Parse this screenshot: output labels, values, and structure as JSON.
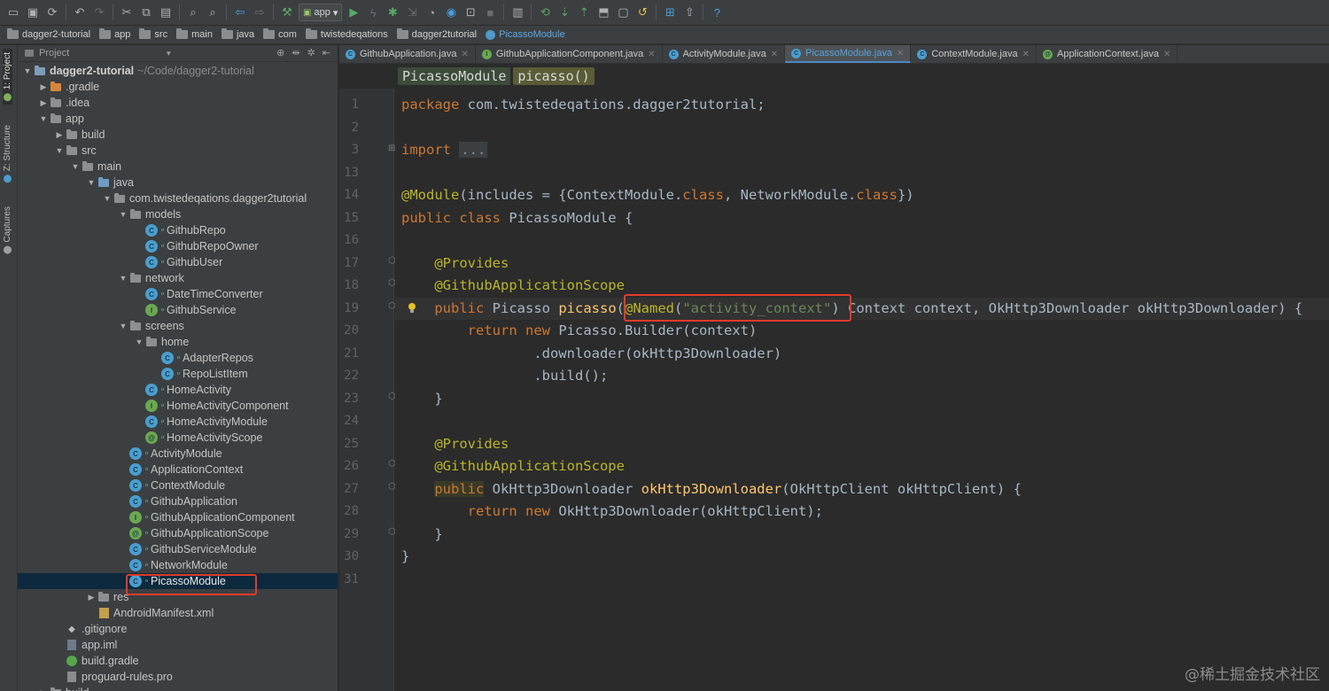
{
  "toolbar": {
    "run_config": "app"
  },
  "navbar": {
    "crumbs": [
      "dagger2-tutorial",
      "app",
      "src",
      "main",
      "java",
      "com",
      "twistedeqations",
      "dagger2tutorial",
      "PicassoModule"
    ]
  },
  "left_stripe": {
    "project_tab": "1: Project",
    "structure_tab": "Z: Structure",
    "captures_tab": "Captures"
  },
  "project_panel": {
    "header": "Project",
    "root_label": "dagger2-tutorial",
    "root_path": "~/Code/dagger2-tutorial",
    "tree": [
      {
        "label": ".gradle"
      },
      {
        "label": ".idea"
      },
      {
        "label": "app"
      },
      {
        "label": "build"
      },
      {
        "label": "src"
      },
      {
        "label": "main"
      },
      {
        "label": "java"
      },
      {
        "label": "com.twistedeqations.dagger2tutorial"
      },
      {
        "label": "models"
      },
      {
        "label": "GithubRepo"
      },
      {
        "label": "GithubRepoOwner"
      },
      {
        "label": "GithubUser"
      },
      {
        "label": "network"
      },
      {
        "label": "DateTimeConverter"
      },
      {
        "label": "GithubService"
      },
      {
        "label": "screens"
      },
      {
        "label": "home"
      },
      {
        "label": "AdapterRepos"
      },
      {
        "label": "RepoListItem"
      },
      {
        "label": "HomeActivity"
      },
      {
        "label": "HomeActivityComponent"
      },
      {
        "label": "HomeActivityModule"
      },
      {
        "label": "HomeActivityScope"
      },
      {
        "label": "ActivityModule"
      },
      {
        "label": "ApplicationContext"
      },
      {
        "label": "ContextModule"
      },
      {
        "label": "GithubApplication"
      },
      {
        "label": "GithubApplicationComponent"
      },
      {
        "label": "GithubApplicationScope"
      },
      {
        "label": "GithubServiceModule"
      },
      {
        "label": "NetworkModule"
      },
      {
        "label": "PicassoModule"
      },
      {
        "label": "res"
      },
      {
        "label": "AndroidManifest.xml"
      },
      {
        "label": ".gitignore"
      },
      {
        "label": "app.iml"
      },
      {
        "label": "build.gradle"
      },
      {
        "label": "proguard-rules.pro"
      },
      {
        "label": "build"
      }
    ]
  },
  "editor": {
    "tabs": [
      {
        "label": "GithubApplication.java",
        "active": false
      },
      {
        "label": "GithubApplicationComponent.java",
        "active": false
      },
      {
        "label": "ActivityModule.java",
        "active": false
      },
      {
        "label": "PicassoModule.java",
        "active": true
      },
      {
        "label": "ContextModule.java",
        "active": false
      },
      {
        "label": "ApplicationContext.java",
        "active": false
      }
    ],
    "breadcrumb_class": "PicassoModule",
    "breadcrumb_method": "picasso()",
    "line_numbers": [
      "1",
      "2",
      "3",
      "13",
      "14",
      "15",
      "16",
      "17",
      "18",
      "19",
      "20",
      "21",
      "22",
      "23",
      "24",
      "25",
      "26",
      "27",
      "28",
      "29",
      "30",
      "31"
    ],
    "code": {
      "l1_kw": "package",
      "l1_rest": " com.twistedeqations.dagger2tutorial;",
      "l3_kw": "import",
      "l3_fold": "...",
      "l14_ann": "@Module",
      "l14_a": "(includes = {ContextModule.",
      "l14_kw1": "class",
      "l14_b": ", NetworkModule.",
      "l14_kw2": "class",
      "l14_c": "})",
      "l15_kw": "public class",
      "l15_rest": " PicassoModule {",
      "l17_ann": "@Provides",
      "l18_ann": "@GithubApplicationScope",
      "l19_kw": "public",
      "l19_a": " Picasso ",
      "l19_fn": "picasso",
      "l19_b": "(",
      "l19_ann": "@Named",
      "l19_c": "(",
      "l19_str": "\"activity_context\"",
      "l19_d": ") Context context, OkHttp3Downloader okHttp3Downloader) {",
      "l20_kw1": "return",
      "l20_kw2": "new",
      "l20_rest": " Picasso.Builder(context)",
      "l21": ".downloader(okHttp3Downloader)",
      "l22": ".build();",
      "l23": "}",
      "l25_ann": "@Provides",
      "l26_ann": "@GithubApplicationScope",
      "l27_kw": "public",
      "l27_a": " OkHttp3Downloader ",
      "l27_fn": "okHttp3Downloader",
      "l27_b": "(OkHttpClient okHttpClient) {",
      "l28_kw1": "return",
      "l28_kw2": "new",
      "l28_rest": " OkHttp3Downloader(okHttpClient);",
      "l29": "}",
      "l30": "}"
    }
  },
  "watermark": "@稀土掘金技术社区"
}
